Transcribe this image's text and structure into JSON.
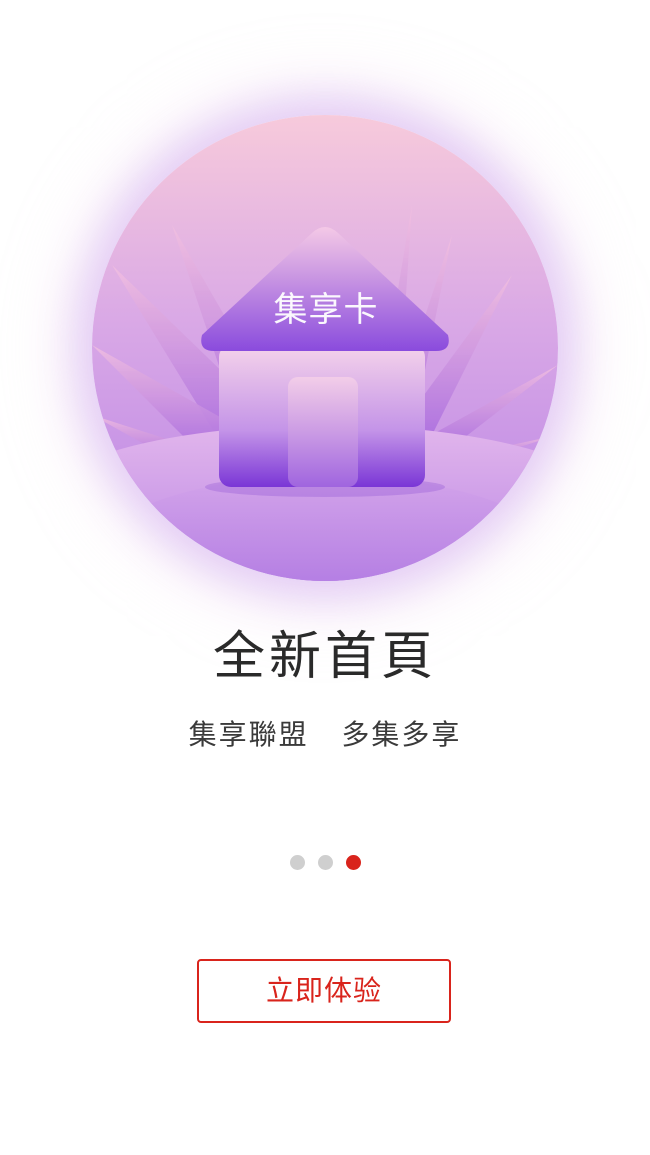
{
  "hero": {
    "house_label": "集享卡",
    "image": "house-illustration"
  },
  "title": "全新首頁",
  "subtitle": "集享聯盟   多集多享",
  "pager": {
    "total": 3,
    "active_index": 2
  },
  "cta": {
    "label": "立即体验"
  },
  "colors": {
    "accent": "#d9241c",
    "dot_inactive": "#cfcfcf",
    "title_text": "#2a2a2a",
    "subtitle_text": "#3a3a3a",
    "hero_top": "#f6c8dc",
    "hero_mid": "#c79ce6",
    "hero_bottom": "#8a4ad8"
  }
}
